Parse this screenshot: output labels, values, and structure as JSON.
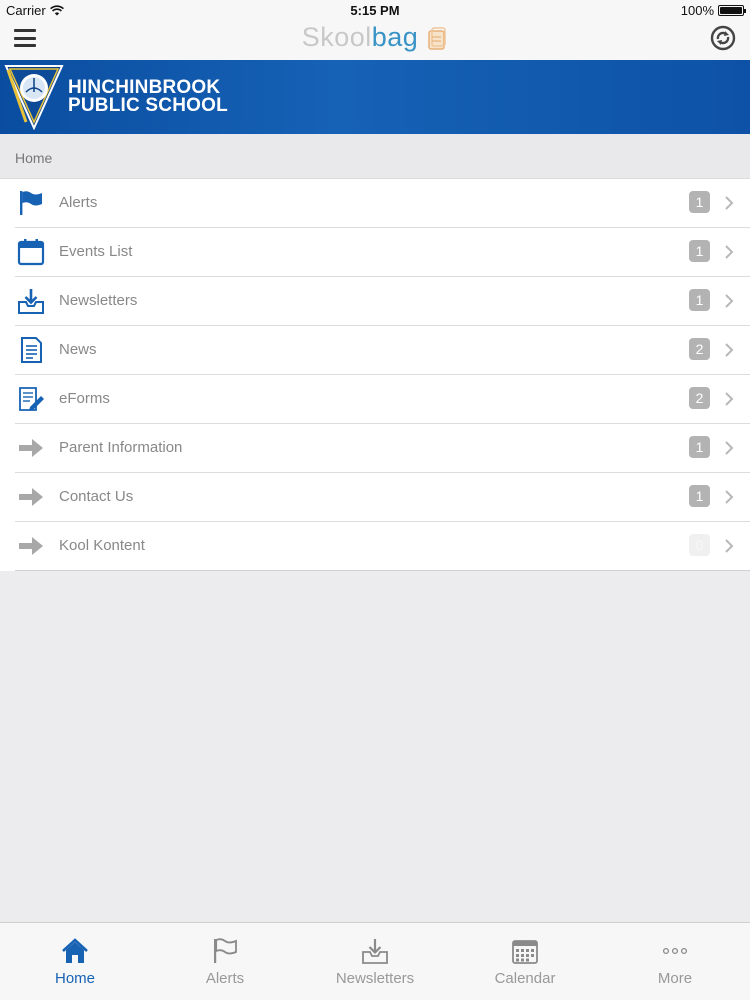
{
  "status_bar": {
    "carrier": "Carrier",
    "time": "5:15 PM",
    "battery": "100%"
  },
  "nav": {
    "logo_part1": "Skool",
    "logo_part2": "bag"
  },
  "banner": {
    "line1": "HINCHINBROOK",
    "line2": "PUBLIC SCHOOL"
  },
  "breadcrumb": "Home",
  "menu": [
    {
      "label": "Alerts",
      "badge": "1",
      "icon": "flag-icon"
    },
    {
      "label": "Events List",
      "badge": "1",
      "icon": "calendar-icon"
    },
    {
      "label": "Newsletters",
      "badge": "1",
      "icon": "inbox-download-icon"
    },
    {
      "label": "News",
      "badge": "2",
      "icon": "document-icon"
    },
    {
      "label": "eForms",
      "badge": "2",
      "icon": "form-pen-icon"
    },
    {
      "label": "Parent Information",
      "badge": "1",
      "icon": "arrow-right-icon"
    },
    {
      "label": "Contact Us",
      "badge": "1",
      "icon": "arrow-right-icon"
    },
    {
      "label": "Kool Kontent",
      "badge": "0",
      "icon": "arrow-right-icon"
    }
  ],
  "tabs": [
    {
      "label": "Home",
      "icon": "home-icon",
      "active": true
    },
    {
      "label": "Alerts",
      "icon": "flag-icon"
    },
    {
      "label": "Newsletters",
      "icon": "inbox-download-icon"
    },
    {
      "label": "Calendar",
      "icon": "calendar-grid-icon"
    },
    {
      "label": "More",
      "icon": "more-dots-icon"
    }
  ],
  "colors": {
    "primary_blue": "#1862b4",
    "banner_blue": "#0d52a6",
    "badge_grey": "#b3b3b3"
  }
}
